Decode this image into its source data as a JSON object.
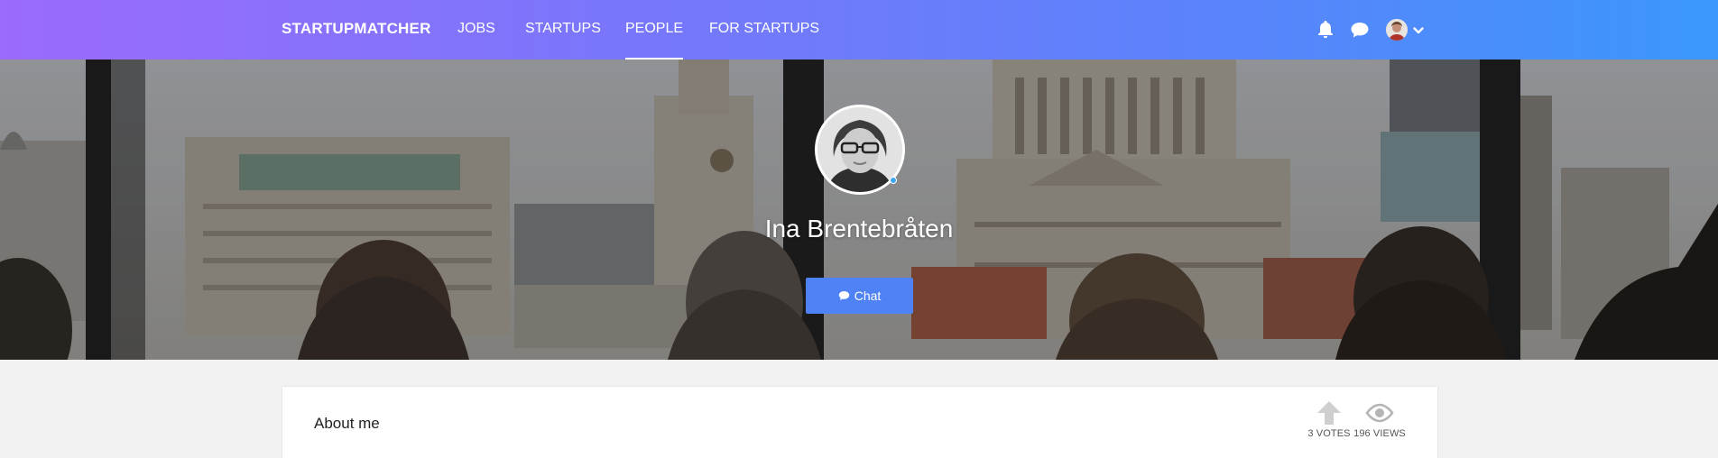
{
  "nav": {
    "brand": "STARTUPMATCHER",
    "links": [
      {
        "label": "JOBS",
        "active": false
      },
      {
        "label": "STARTUPS",
        "active": false
      },
      {
        "label": "PEOPLE",
        "active": true
      },
      {
        "label": "FOR STARTUPS",
        "active": false
      }
    ],
    "icons": [
      "bell-icon",
      "chat-bubble-icon",
      "user-avatar",
      "chevron-down-icon"
    ]
  },
  "profile": {
    "name": "Ina Brentebråten",
    "chat_button_label": "Chat",
    "chat_icon": "comment-icon",
    "online": true
  },
  "about": {
    "title": "About me",
    "votes_label": "3 VOTES",
    "views_label": "196 VIEWS"
  },
  "colors": {
    "nav_gradient_start": "#9b6bfb",
    "nav_gradient_end": "#3b97fb",
    "chat_button": "#4f82f4",
    "page_background": "#f2f2f2"
  }
}
